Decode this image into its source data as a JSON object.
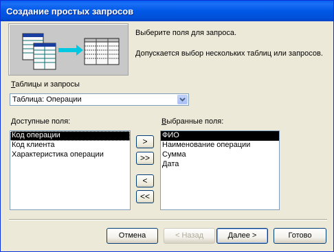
{
  "window": {
    "title": "Создание простых запросов"
  },
  "intro": {
    "line1": "Выберите поля для запроса.",
    "line2": "Допускается выбор нескольких таблиц или запросов."
  },
  "tables": {
    "label_prefix": "Т",
    "label_rest": "аблицы и запросы",
    "selected": "Таблица: Операции"
  },
  "available": {
    "label_prefix": "Д",
    "label_rest": "оступные поля:",
    "items": [
      "Код операции",
      "Код клиента",
      "Характеристика операции"
    ]
  },
  "selected_fields": {
    "label_prefix": "В",
    "label_rest": "ыбранные поля:",
    "items": [
      "ФИО",
      "Наименование операции",
      "Сумма",
      "Дата"
    ]
  },
  "move": {
    "add_one": ">",
    "add_all": ">>",
    "remove_one": "<",
    "remove_all": "<<"
  },
  "buttons": {
    "cancel": "Отмена",
    "back": "< Назад",
    "next": "Далее >",
    "finish": "Готово"
  },
  "colors": {
    "titlebar": "#0058e6",
    "dialog": "#ece9d8",
    "selection": "#000000"
  }
}
